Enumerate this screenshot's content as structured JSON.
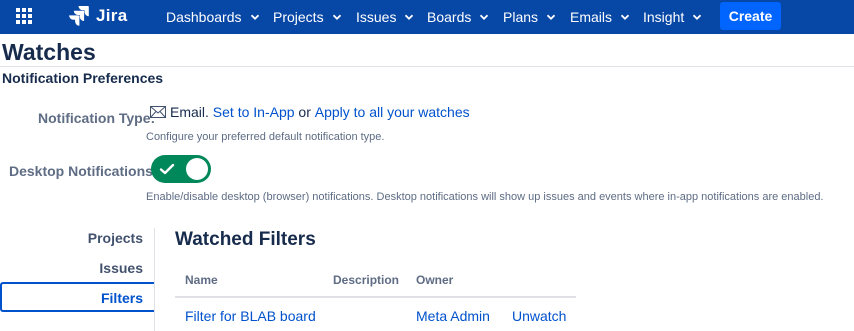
{
  "nav": {
    "brand": "Jira",
    "items": [
      {
        "label": "Dashboards"
      },
      {
        "label": "Projects"
      },
      {
        "label": "Issues"
      },
      {
        "label": "Boards"
      },
      {
        "label": "Plans"
      },
      {
        "label": "Emails"
      },
      {
        "label": "Insight"
      }
    ],
    "create_label": "Create"
  },
  "page": {
    "title": "Watches",
    "section_title": "Notification Preferences"
  },
  "preferences": {
    "notification_type": {
      "label": "Notification Type:",
      "current": "Email.",
      "set_inapp_link": "Set to In-App",
      "or_text": "or",
      "apply_all_link": "Apply to all your watches",
      "help": "Configure your preferred default notification type."
    },
    "desktop": {
      "label": "Desktop Notifications:",
      "enabled": true,
      "help": "Enable/disable desktop (browser) notifications. Desktop notifications will show up issues and events where in-app notifications are enabled."
    }
  },
  "sidebar": {
    "items": [
      {
        "label": "Projects",
        "active": false
      },
      {
        "label": "Issues",
        "active": false
      },
      {
        "label": "Filters",
        "active": true
      }
    ]
  },
  "main": {
    "title": "Watched Filters",
    "columns": [
      "Name",
      "Description",
      "Owner"
    ],
    "rows": [
      {
        "name": "Filter for BLAB board",
        "description": "",
        "owner": "Meta Admin",
        "action": "Unwatch"
      }
    ]
  },
  "colors": {
    "nav_bg": "#0747a6",
    "create_bg": "#0065ff",
    "link": "#0052cc",
    "toggle_on": "#00875a"
  }
}
